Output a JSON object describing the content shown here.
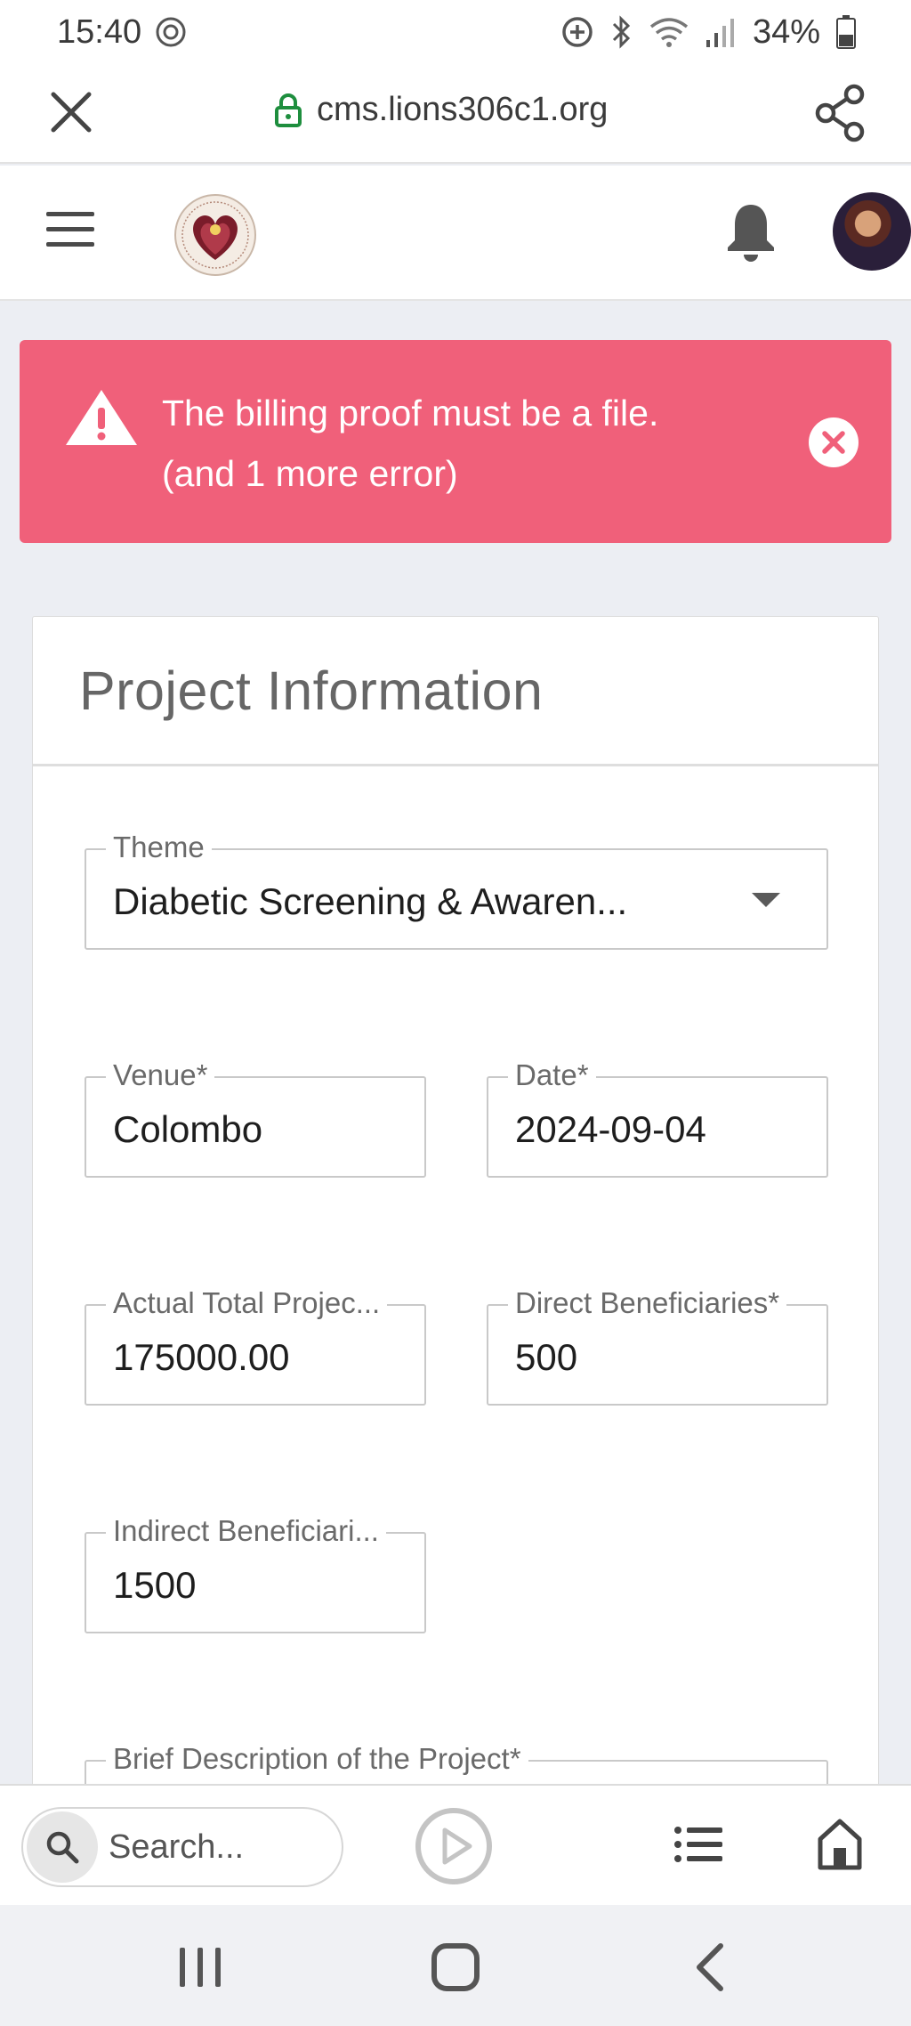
{
  "status_bar": {
    "time": "15:40",
    "battery": "34%"
  },
  "browser": {
    "url": "cms.lions306c1.org"
  },
  "alert": {
    "line1": "The billing proof must be a file.",
    "line2": "(and 1 more error)",
    "color": "#f0607a"
  },
  "form": {
    "title": "Project Information",
    "theme": {
      "label": "Theme",
      "value": "Diabetic Screening & Awaren..."
    },
    "venue": {
      "label": "Venue*",
      "value": "Colombo"
    },
    "date": {
      "label": "Date*",
      "value": "2024-09-04"
    },
    "actual_total": {
      "label": "Actual Total Projec...",
      "value": "175000.00"
    },
    "direct_beneficiaries": {
      "label": "Direct Beneficiaries*",
      "value": "500"
    },
    "indirect_beneficiaries": {
      "label": "Indirect Beneficiari...",
      "value": "1500"
    },
    "brief_description": {
      "label": "Brief Description of the Project*",
      "value": ""
    }
  },
  "bottom_toolbar": {
    "search_placeholder": "Search..."
  },
  "icons": {
    "status_left": [
      "clock-icon"
    ],
    "status_right": [
      "data-saver-icon",
      "bluetooth-icon",
      "wifi-icon",
      "signal-icon",
      "battery-icon"
    ],
    "browser": [
      "close-icon",
      "lock-icon",
      "share-icon"
    ],
    "header": [
      "hamburger-menu-icon",
      "lions-club-logo",
      "bell-icon",
      "user-avatar"
    ],
    "nav": [
      "recents-icon",
      "home-icon",
      "back-icon"
    ]
  }
}
